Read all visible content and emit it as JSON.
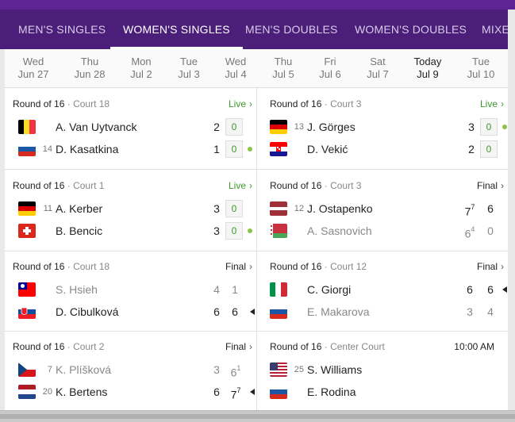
{
  "tabs": [
    {
      "label": "MEN'S SINGLES",
      "active": false
    },
    {
      "label": "WOMEN'S SINGLES",
      "active": true
    },
    {
      "label": "MEN'S DOUBLES",
      "active": false
    },
    {
      "label": "WOMEN'S DOUBLES",
      "active": false
    },
    {
      "label": "MIXE",
      "active": false
    }
  ],
  "dates": [
    {
      "day": "Wed",
      "date": "Jun 27"
    },
    {
      "day": "Thu",
      "date": "Jun 28"
    },
    {
      "day": "Mon",
      "date": "Jul 2"
    },
    {
      "day": "Tue",
      "date": "Jul 3"
    },
    {
      "day": "Wed",
      "date": "Jul 4"
    },
    {
      "day": "Thu",
      "date": "Jul 5"
    },
    {
      "day": "Fri",
      "date": "Jul 6"
    },
    {
      "day": "Sat",
      "date": "Jul 7"
    },
    {
      "day": "Today",
      "date": "Jul 9"
    },
    {
      "day": "Tue",
      "date": "Jul 10"
    }
  ],
  "separator": "·",
  "colors": {
    "live": "#3c9a28",
    "purple": "#4b1e7a"
  },
  "matches": [
    {
      "round": "Round of 16",
      "court": "Court 18",
      "status": "Live",
      "p1": {
        "flag": "belgium",
        "seed": "",
        "name": "A. Van Uytvanck",
        "s1": "2",
        "game": "0"
      },
      "p2": {
        "flag": "russia",
        "seed": "14",
        "name": "D. Kasatkina",
        "s1": "1",
        "game": "0"
      }
    },
    {
      "round": "Round of 16",
      "court": "Court 3",
      "status": "Live",
      "p1": {
        "flag": "germany",
        "seed": "13",
        "name": "J. Görges",
        "s1": "3",
        "game": "0"
      },
      "p2": {
        "flag": "croatia",
        "seed": "",
        "name": "D. Vekić",
        "s1": "2",
        "game": "0"
      }
    },
    {
      "round": "Round of 16",
      "court": "Court 1",
      "status": "Live",
      "p1": {
        "flag": "germany",
        "seed": "11",
        "name": "A. Kerber",
        "s1": "3",
        "game": "0"
      },
      "p2": {
        "flag": "switzerland",
        "seed": "",
        "name": "B. Bencic",
        "s1": "3",
        "game": "0"
      }
    },
    {
      "round": "Round of 16",
      "court": "Court 3",
      "status": "Final",
      "p1": {
        "flag": "latvia",
        "seed": "12",
        "name": "J. Ostapenko",
        "s1": "7",
        "s1sup": "7",
        "s2": "6"
      },
      "p2": {
        "flag": "belarus",
        "seed": "",
        "name": "A. Sasnovich",
        "s1": "6",
        "s1sup": "4",
        "s2": "0"
      }
    },
    {
      "round": "Round of 16",
      "court": "Court 18",
      "status": "Final",
      "p1": {
        "flag": "taiwan",
        "seed": "",
        "name": "S. Hsieh",
        "s1": "4",
        "s2": "1"
      },
      "p2": {
        "flag": "slovakia",
        "seed": "",
        "name": "D. Cibulková",
        "s1": "6",
        "s2": "6"
      }
    },
    {
      "round": "Round of 16",
      "court": "Court 12",
      "status": "Final",
      "p1": {
        "flag": "italy",
        "seed": "",
        "name": "C. Giorgi",
        "s1": "6",
        "s2": "6"
      },
      "p2": {
        "flag": "russia",
        "seed": "",
        "name": "E. Makarova",
        "s1": "3",
        "s2": "4"
      }
    },
    {
      "round": "Round of 16",
      "court": "Court 2",
      "status": "Final",
      "p1": {
        "flag": "czech",
        "seed": "7",
        "name": "K. Plíšková",
        "s1": "3",
        "s2": "6",
        "s2sup": "1"
      },
      "p2": {
        "flag": "netherlands",
        "seed": "20",
        "name": "K. Bertens",
        "s1": "6",
        "s2": "7",
        "s2sup": "7"
      }
    },
    {
      "round": "Round of 16",
      "court": "Center Court",
      "status": "10:00 AM",
      "p1": {
        "flag": "usa",
        "seed": "25",
        "name": "S. Williams"
      },
      "p2": {
        "flag": "russia",
        "seed": "",
        "name": "E. Rodina"
      }
    }
  ]
}
